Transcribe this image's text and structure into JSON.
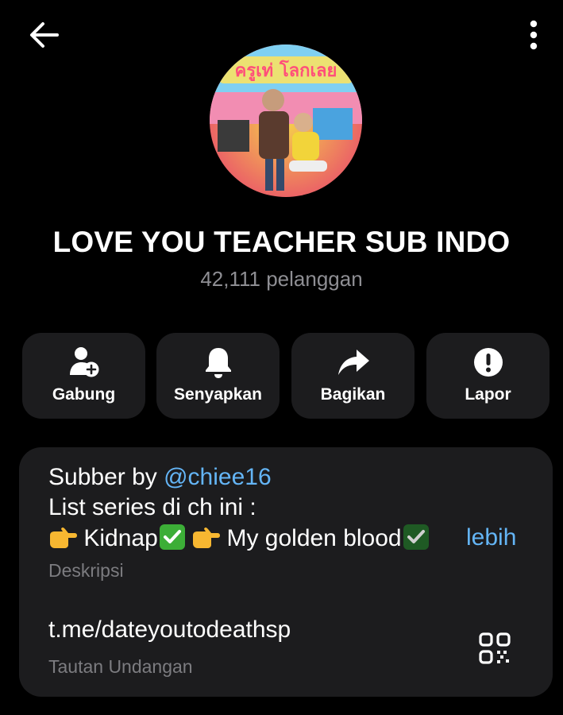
{
  "header": {
    "back_icon": "arrow-left-icon",
    "menu_icon": "more-vertical-icon"
  },
  "channel": {
    "title": "LOVE YOU TEACHER SUB INDO",
    "subscribers": "42,111 pelanggan",
    "avatar_text": "ครูเท่ โลกเลย"
  },
  "actions": [
    {
      "label": "Gabung",
      "icon": "add-user-icon"
    },
    {
      "label": "Senyapkan",
      "icon": "bell-icon"
    },
    {
      "label": "Bagikan",
      "icon": "share-arrow-icon"
    },
    {
      "label": "Lapor",
      "icon": "alert-circle-icon"
    }
  ],
  "description": {
    "line1_prefix": "Subber by ",
    "line1_mention": "@chiee16",
    "line2": "List series di ch ini :",
    "line3_item1": "Kidnap",
    "line3_item2": "My golden blood",
    "more_label": "lebih",
    "label": "Deskripsi"
  },
  "invite": {
    "link": "t.me/dateyoutodeathsp",
    "label": "Tautan Undangan",
    "qr_icon": "qr-code-icon"
  },
  "colors": {
    "background": "#000000",
    "card": "#1c1c1e",
    "accent": "#64b5f6",
    "secondary_text": "#8e8e93",
    "check_green": "#3cae37"
  }
}
